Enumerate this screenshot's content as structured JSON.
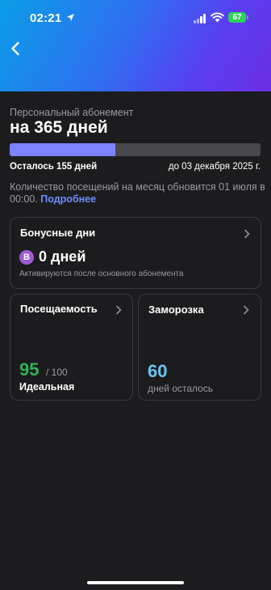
{
  "status_bar": {
    "time": "02:21",
    "battery": "67"
  },
  "subscription": {
    "label": "Персональный абонемент",
    "title": "на 365 дней",
    "progress_fraction": 0.42,
    "remaining": "Осталось 155 дней",
    "until": "до 03 декабря 2025 г.",
    "notice": "Количество посещений на месяц обновится 01 июля в 00:00.",
    "more_link": "Подробнее"
  },
  "bonus_days": {
    "title": "Бонусные дни",
    "badge": "B",
    "value": "0 дней",
    "note": "Активируются после основного абонемента"
  },
  "attendance": {
    "title": "Посещаемость",
    "score": "95",
    "max": "/ 100",
    "status": "Идеальная"
  },
  "freeze": {
    "title": "Заморозка",
    "value": "60",
    "label": "дней осталось"
  },
  "colors": {
    "progress_fill": "#7b83ff",
    "attendance_score": "#30b05a",
    "freeze_value": "#6ac4ef",
    "link": "#6f8cff",
    "battery": "#30d158"
  }
}
